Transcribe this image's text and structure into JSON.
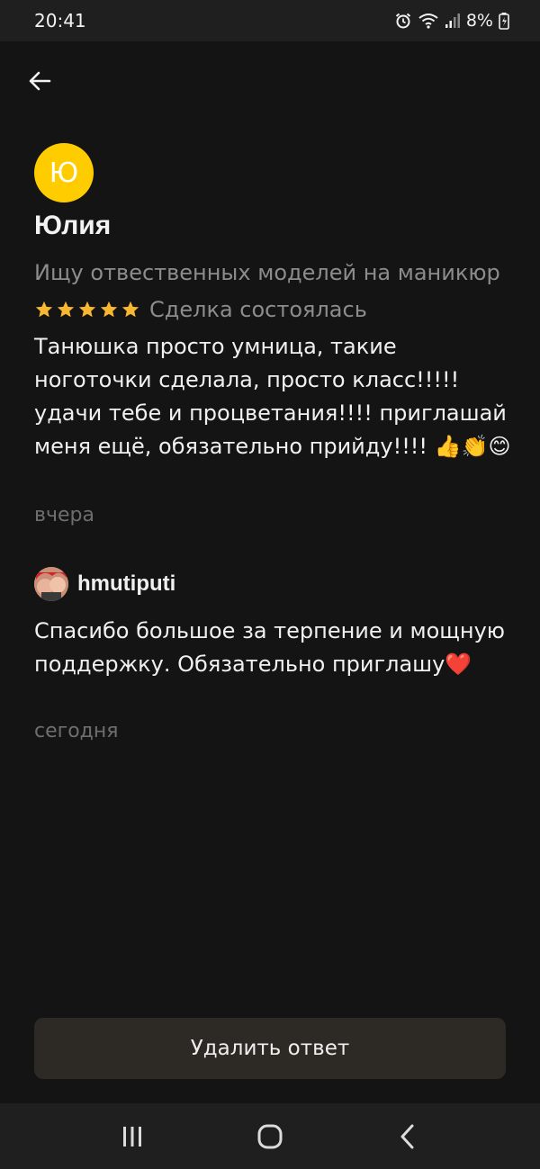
{
  "status_bar": {
    "time": "20:41",
    "battery": "8%",
    "icons": [
      "alarm-icon",
      "wifi-icon",
      "signal-icon",
      "battery-icon"
    ]
  },
  "review": {
    "avatar_letter": "Ю",
    "avatar_color": "#ffcc00",
    "author": "Юлия",
    "listing_title": "Ищу отвественных моделей на маникюр",
    "rating": 5,
    "rating_max": 5,
    "deal_status": "Сделка состоялась",
    "text": "Танюшка просто умница, такие ноготочки сделала, просто класс!!!!! удачи тебе и процветания!!!! приглашай меня ещё, обязательно прийду!!!! 👍👏😊",
    "date": "вчера"
  },
  "reply": {
    "author": "hmutiputi",
    "text": "Спасибо большое за терпение и мощную поддержку. Обязательно приглашу❤️",
    "date": "сегодня"
  },
  "actions": {
    "delete_label": "Удалить ответ"
  },
  "colors": {
    "background": "#141414",
    "star": "#f7b731",
    "button_bg": "#2d2a25"
  }
}
